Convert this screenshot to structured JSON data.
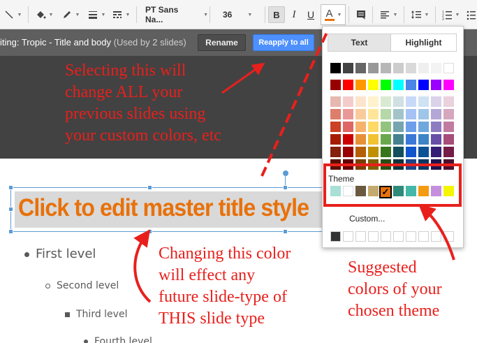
{
  "toolbar": {
    "font_name": "PT Sans Na...",
    "font_size": "36",
    "bold_label": "B",
    "italic_label": "I",
    "underline_label": "U",
    "text_color_label": "A"
  },
  "master_bar": {
    "title": "iting: Tropic - Title and body",
    "used": "(Used by 2 slides)",
    "rename_label": "Rename",
    "reapply_label": "Reapply to all"
  },
  "annotations": {
    "top": [
      "Selecting this will",
      "change ALL your",
      "previous slides using",
      "your custom colors, etc"
    ],
    "middle": [
      "Changing this color",
      "will effect any",
      "future slide-type of",
      "THIS slide type"
    ],
    "right": [
      "Suggested",
      "colors of your",
      "chosen theme"
    ]
  },
  "slide": {
    "title": "Click to edit master title style",
    "level1": "First level",
    "level2": "Second level",
    "level3": "Third level",
    "level4": "Fourth level"
  },
  "color_popup": {
    "tab_text": "Text",
    "tab_highlight": "Highlight",
    "theme_label": "Theme",
    "custom_label": "Custom...",
    "grayscale": [
      "#000000",
      "#434343",
      "#666666",
      "#999999",
      "#b7b7b7",
      "#cccccc",
      "#d9d9d9",
      "#efefef",
      "#f3f3f3",
      "#ffffff"
    ],
    "bright": [
      "#980000",
      "#ff0000",
      "#ff9900",
      "#ffff00",
      "#00ff00",
      "#00ffff",
      "#4a86e8",
      "#0000ff",
      "#9900ff",
      "#ff00ff"
    ],
    "shades": [
      [
        "#e6b8af",
        "#f4cccc",
        "#fce5cd",
        "#fff2cc",
        "#d9ead3",
        "#d0e0e3",
        "#c9daf8",
        "#cfe2f3",
        "#d9d2e9",
        "#ead1dc"
      ],
      [
        "#dd7e6b",
        "#ea9999",
        "#f9cb9c",
        "#ffe599",
        "#b6d7a8",
        "#a2c4c9",
        "#a4c2f4",
        "#9fc5e8",
        "#b4a7d6",
        "#d5a6bd"
      ],
      [
        "#cc4125",
        "#e06666",
        "#f6b26b",
        "#ffd966",
        "#93c47d",
        "#76a5af",
        "#6d9eeb",
        "#6fa8dc",
        "#8e7cc3",
        "#c27ba0"
      ],
      [
        "#a61c00",
        "#cc0000",
        "#e69138",
        "#f1c232",
        "#6aa84f",
        "#45818e",
        "#3c78d8",
        "#3d85c6",
        "#674ea7",
        "#a64d79"
      ],
      [
        "#85200c",
        "#990000",
        "#b45f06",
        "#bf9000",
        "#38761d",
        "#134f5c",
        "#1155cc",
        "#0b5394",
        "#351c75",
        "#741b47"
      ],
      [
        "#5b0f00",
        "#660000",
        "#783f04",
        "#7f6000",
        "#274e13",
        "#0c343d",
        "#1c4587",
        "#073763",
        "#20124d",
        "#4c1130"
      ]
    ],
    "theme_colors": [
      "#a8e0d6",
      "#ffffff",
      "#6b5a3f",
      "#c4aa6e",
      "#e8710a",
      "#2e8b7a",
      "#44b8a8",
      "#f39c12",
      "#c58fde",
      "#f5f500"
    ],
    "custom_colors": [
      "#333333",
      "#ffffff",
      "#ffffff",
      "#ffffff",
      "#ffffff",
      "#ffffff",
      "#ffffff",
      "#ffffff",
      "#ffffff",
      "#ffffff"
    ]
  }
}
